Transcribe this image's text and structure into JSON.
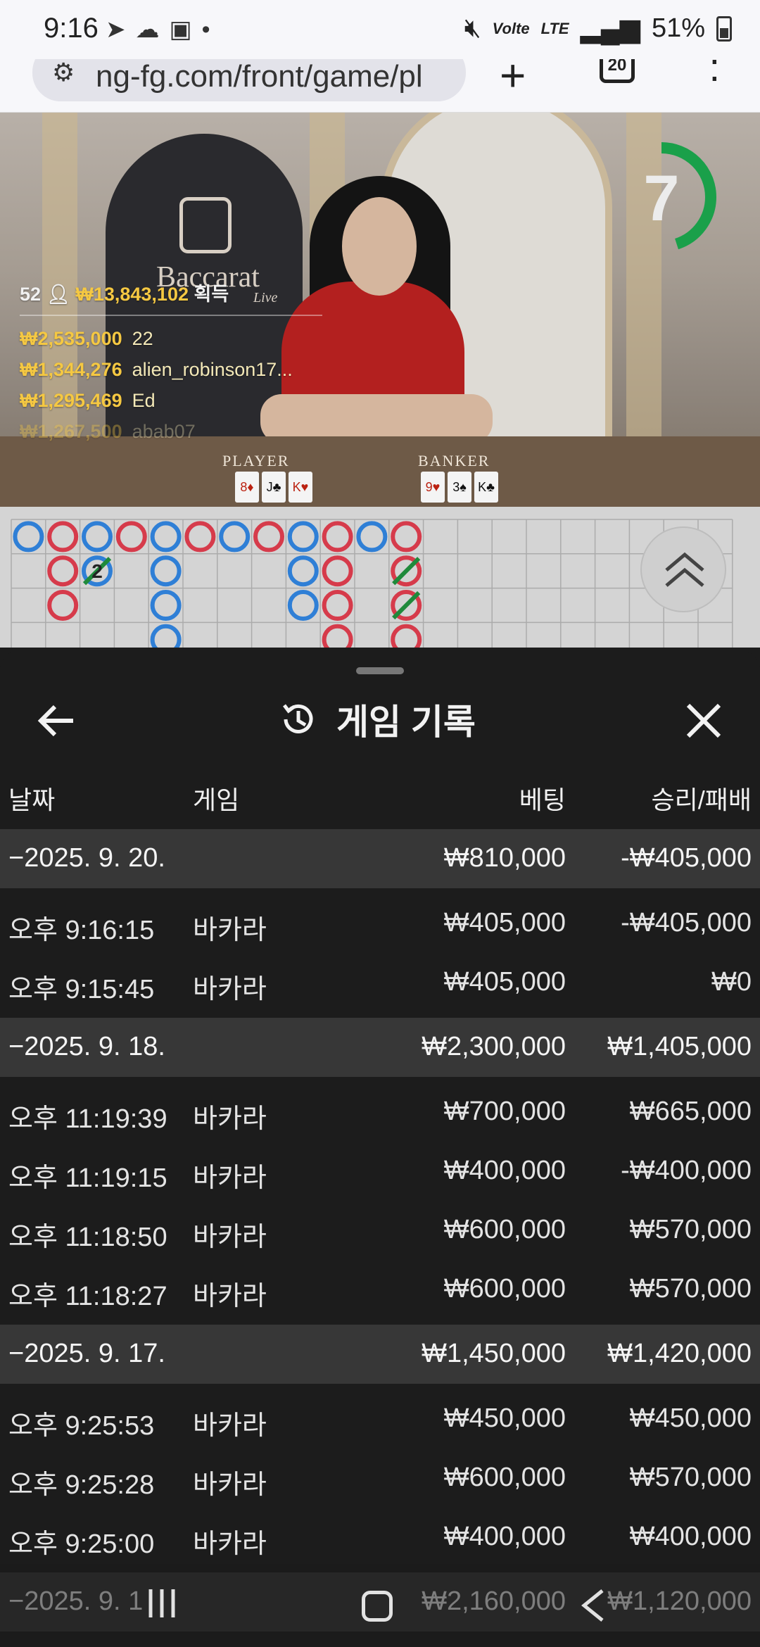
{
  "status_bar": {
    "time": "9:16",
    "left_icons": [
      "telegram-icon",
      "cloud-icon",
      "gallery-icon",
      "dot-icon"
    ],
    "volte": "Volte",
    "lte": "LTE",
    "battery": "51%"
  },
  "browser": {
    "url": "ng-fg.com/front/game/pl",
    "tab_count": "20"
  },
  "live_game": {
    "table_name": "Baccarat",
    "table_sub": "Live",
    "player_count": "52",
    "total_win": "₩13,843,102",
    "total_win_label": "획득",
    "winners": [
      {
        "amount": "₩2,535,000",
        "name": "22"
      },
      {
        "amount": "₩1,344,276",
        "name": "alien_robinson17..."
      },
      {
        "amount": "₩1,295,469",
        "name": "Ed"
      },
      {
        "amount": "₩1,267,500",
        "name": "abab07"
      }
    ],
    "countdown": "7",
    "countdown_fraction": 0.45,
    "player_label": "PLAYER",
    "banker_label": "BANKER",
    "player_cards": [
      "8♦",
      "J♣",
      "K♥"
    ],
    "banker_cards": [
      "9♥",
      "3♠",
      "K♣"
    ]
  },
  "roadmap": {
    "tie_count": "2",
    "colors": {
      "banker": "#d63b4b",
      "player": "#2f7fd6",
      "tie": "#1f8a3b"
    }
  },
  "history": {
    "title": "게임 기록",
    "columns": {
      "date": "날짜",
      "game": "게임",
      "bet": "베팅",
      "winloss": "승리/패배"
    },
    "groups": [
      {
        "date": "−2025. 9. 20.",
        "bet": "₩810,000",
        "winloss": "-₩405,000",
        "rows": [
          {
            "time": "오후 9:16:15",
            "game": "바카라",
            "bet": "₩405,000",
            "winloss": "-₩405,000"
          },
          {
            "time": "오후 9:15:45",
            "game": "바카라",
            "bet": "₩405,000",
            "winloss": "₩0"
          }
        ]
      },
      {
        "date": "−2025. 9. 18.",
        "bet": "₩2,300,000",
        "winloss": "₩1,405,000",
        "rows": [
          {
            "time": "오후 11:19:39",
            "game": "바카라",
            "bet": "₩700,000",
            "winloss": "₩665,000"
          },
          {
            "time": "오후 11:19:15",
            "game": "바카라",
            "bet": "₩400,000",
            "winloss": "-₩400,000"
          },
          {
            "time": "오후 11:18:50",
            "game": "바카라",
            "bet": "₩600,000",
            "winloss": "₩570,000"
          },
          {
            "time": "오후 11:18:27",
            "game": "바카라",
            "bet": "₩600,000",
            "winloss": "₩570,000"
          }
        ]
      },
      {
        "date": "−2025. 9. 17.",
        "bet": "₩1,450,000",
        "winloss": "₩1,420,000",
        "rows": [
          {
            "time": "오후 9:25:53",
            "game": "바카라",
            "bet": "₩450,000",
            "winloss": "₩450,000"
          },
          {
            "time": "오후 9:25:28",
            "game": "바카라",
            "bet": "₩600,000",
            "winloss": "₩570,000"
          },
          {
            "time": "오후 9:25:00",
            "game": "바카라",
            "bet": "₩400,000",
            "winloss": "₩400,000"
          }
        ]
      },
      {
        "date": "−2025. 9. 1",
        "bet": "₩2,160,000",
        "winloss": "₩1,120,000",
        "rows": []
      }
    ]
  }
}
